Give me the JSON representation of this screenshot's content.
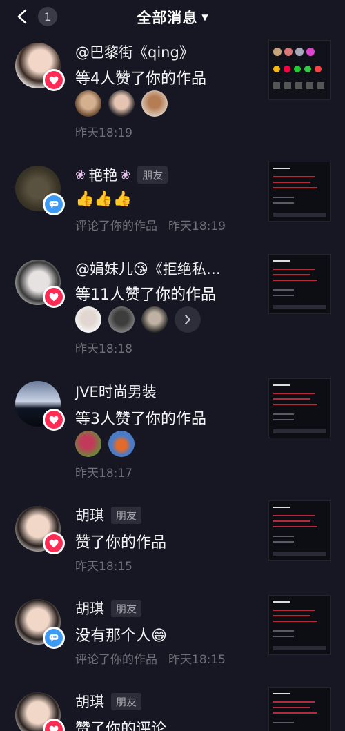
{
  "header": {
    "title": "全部消息",
    "badge": "1"
  },
  "items": [
    {
      "name": "@巴黎街《qing》",
      "action": "等4人赞了你的作品",
      "time": "昨天18:19",
      "type": "like"
    },
    {
      "name": "艳艳",
      "tag": "朋友",
      "action": "👍👍👍",
      "meta_prefix": "评论了你的作品",
      "time": "昨天18:19",
      "type": "comment"
    },
    {
      "name": "@娟妹儿😘《拒绝私…",
      "action": "等11人赞了你的作品",
      "time": "昨天18:18",
      "type": "like"
    },
    {
      "name": "JVE时尚男装",
      "action": "等3人赞了你的作品",
      "time": "昨天18:17",
      "type": "like"
    },
    {
      "name": "胡琪",
      "tag": "朋友",
      "action": "赞了你的作品",
      "time": "昨天18:15",
      "type": "like"
    },
    {
      "name": "胡琪",
      "tag": "朋友",
      "action": "没有那个人😁",
      "meta_prefix": "评论了你的作品",
      "time": "昨天18:15",
      "type": "comment"
    },
    {
      "name": "胡琪",
      "tag": "朋友",
      "action": "赞了你的评论",
      "type": "like"
    }
  ],
  "colors": {
    "background": "#161722",
    "like": "#fe2c55",
    "comment": "#3e9bf5",
    "muted": "#6f7079"
  }
}
